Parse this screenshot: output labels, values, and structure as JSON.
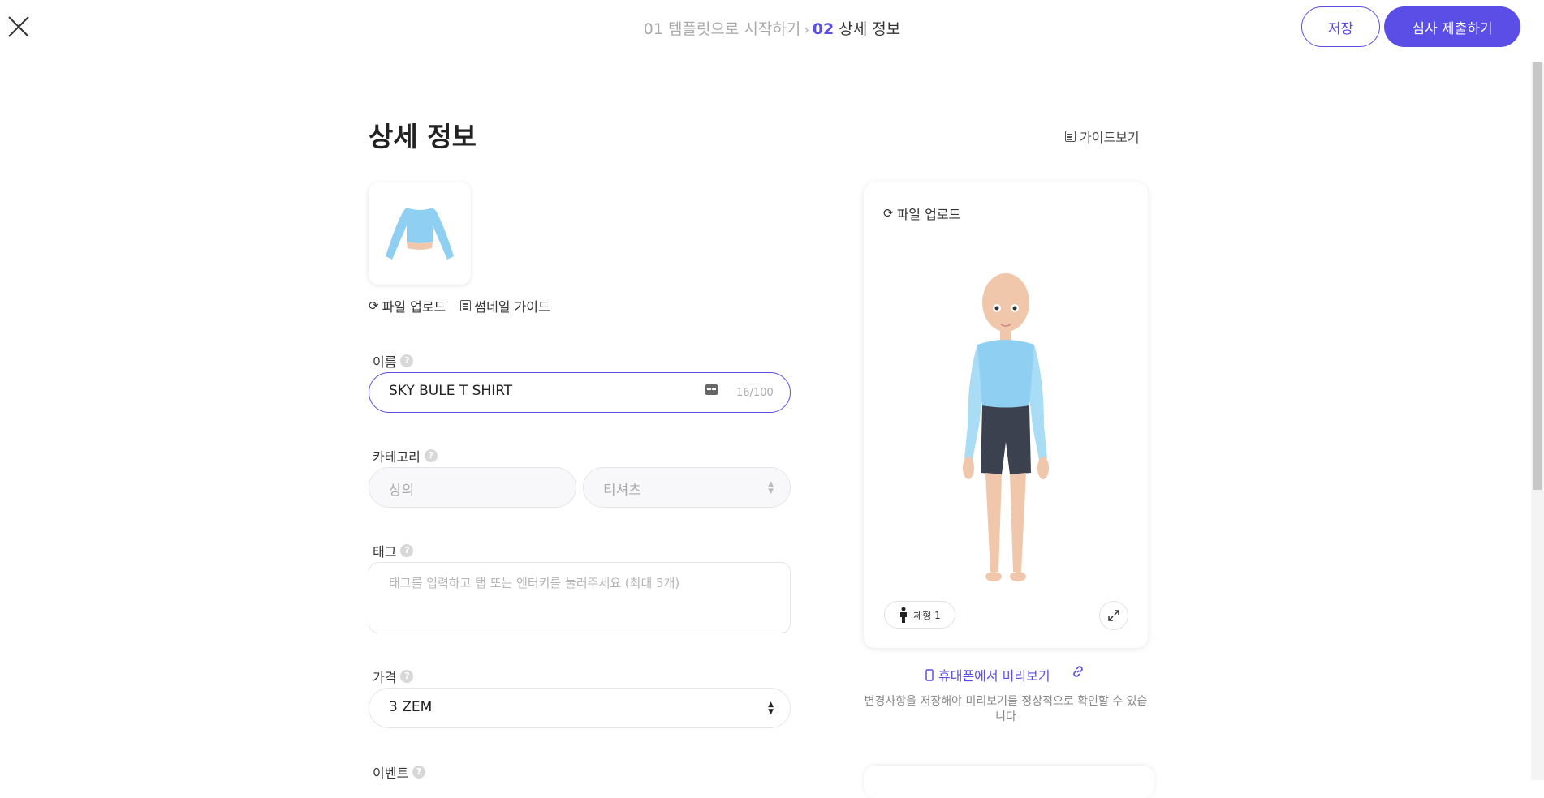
{
  "header": {
    "steps": [
      {
        "num": "01",
        "label": "템플릿으로 시작하기"
      },
      {
        "num": "02",
        "label": "상세 정보"
      }
    ],
    "save_label": "저장",
    "submit_label": "심사 제출하기",
    "step_separator": "›"
  },
  "page": {
    "title": "상세 정보",
    "guide_label": "가이드보기"
  },
  "thumbnail": {
    "upload_label": "파일 업로드",
    "guide_label": "썸네일 가이드"
  },
  "form": {
    "name": {
      "label": "이름",
      "value": "SKY BULE T SHIRT",
      "counter": "16/100"
    },
    "category": {
      "label": "카테고리",
      "primary": "상의",
      "secondary": "티셔츠"
    },
    "tag": {
      "label": "태그",
      "placeholder": "태그를 입력하고 탭 또는 엔터키를 눌러주세요 (최대 5개)"
    },
    "price": {
      "label": "가격",
      "value": "3 ZEM"
    },
    "event": {
      "label": "이벤트"
    }
  },
  "preview": {
    "upload_label": "파일 업로드",
    "body_type_label": "체형 1",
    "mobile_preview_label": "휴대폰에서 미리보기",
    "notice": "변경사항을 저장해야 미리보기를 정상적으로 확인할 수 있습니다"
  },
  "colors": {
    "accent": "#5a4ee6",
    "shirt": "#8fd0f2",
    "shorts": "#3c4150",
    "skin": "#f0c7aa"
  }
}
